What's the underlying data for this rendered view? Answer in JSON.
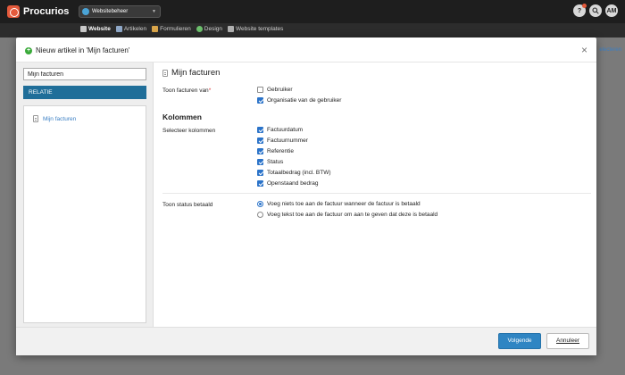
{
  "app": {
    "brand": "Procurios",
    "workspace": "Websitebeheer",
    "avatar_initials": "AM",
    "help_label": "?"
  },
  "subnav": {
    "items": [
      {
        "label": "Website",
        "active": true
      },
      {
        "label": "Artikelen",
        "active": false
      },
      {
        "label": "Formulieren",
        "active": false
      },
      {
        "label": "Design",
        "active": false
      },
      {
        "label": "Website templates",
        "active": false
      }
    ]
  },
  "background": {
    "right_link": "electeren"
  },
  "modal": {
    "title": "Nieuw artikel in 'Mijn facturen'",
    "close_label": "×",
    "name_value": "Mijn facturen",
    "relatie_tab": "RELATIE",
    "tree_item": "Mijn facturen",
    "article_title": "Mijn facturen",
    "toon_facturen_label": "Toon facturen van",
    "toon_facturen_required": "*",
    "toon_facturen_options": [
      {
        "label": "Gebruiker",
        "checked": false
      },
      {
        "label": "Organisatie van de gebruiker",
        "checked": true
      }
    ],
    "kolommen_heading": "Kolommen",
    "selecteer_label": "Selecteer kolommen",
    "kolommen_options": [
      {
        "label": "Factuurdatum",
        "checked": true
      },
      {
        "label": "Factuurnummer",
        "checked": true
      },
      {
        "label": "Referentie",
        "checked": true
      },
      {
        "label": "Status",
        "checked": true
      },
      {
        "label": "Totaalbedrag (incl. BTW)",
        "checked": true
      },
      {
        "label": "Openstaand bedrag",
        "checked": true
      }
    ],
    "status_label": "Toon status betaald",
    "status_options": [
      {
        "label": "Voeg niets toe aan de factuur wanneer de factuur is betaald",
        "selected": true
      },
      {
        "label": "Voeg tekst toe aan de factuur om aan te geven dat deze is betaald",
        "selected": false
      }
    ],
    "primary_button": "Volgende",
    "secondary_button": "Annuleer"
  },
  "colors": {
    "accent": "#2f85c3",
    "relatie_tab": "#1f6e99",
    "brand": "#e45a3c"
  }
}
